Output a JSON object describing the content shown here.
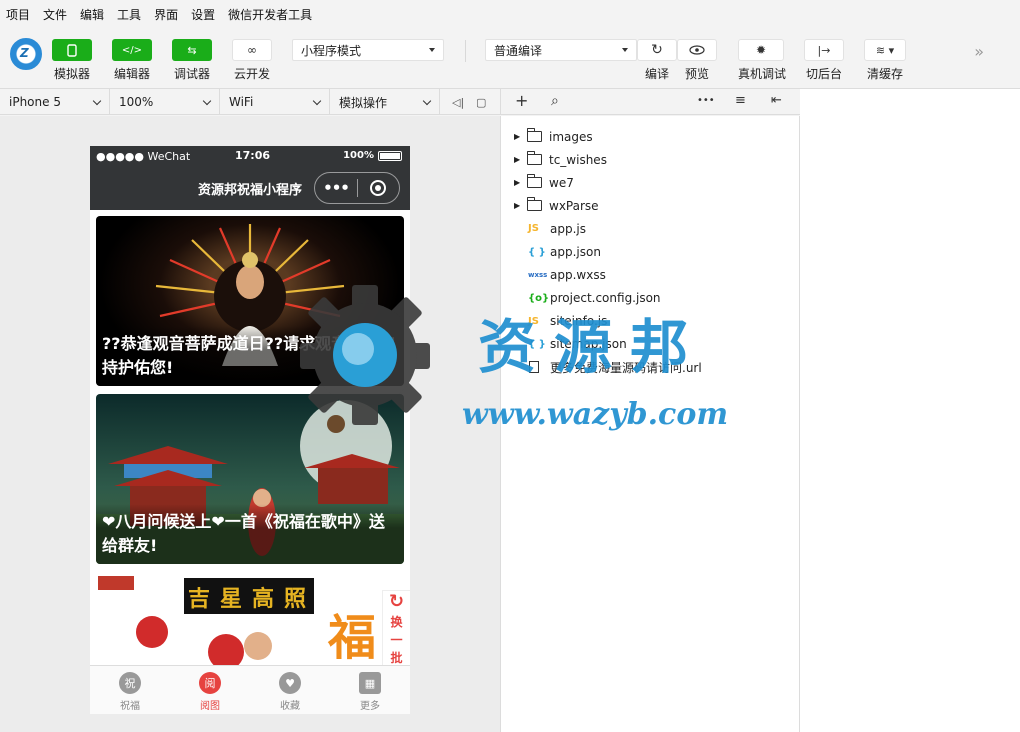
{
  "menu": [
    "项目",
    "文件",
    "编辑",
    "工具",
    "界面",
    "设置",
    "微信开发者工具"
  ],
  "toolbar": {
    "simulator": "模拟器",
    "editor": "编辑器",
    "debugger": "调试器",
    "cloud": "云开发",
    "mode": "小程序模式",
    "compile_mode": "普通编译",
    "compile": "编译",
    "preview": "预览",
    "remote_debug": "真机调试",
    "background": "切后台",
    "clear_cache": "清缓存"
  },
  "subbar": {
    "device": "iPhone 5",
    "zoom": "100%",
    "network": "WiFi",
    "operation": "模拟操作"
  },
  "phone": {
    "carrier": "●●●●● WeChat",
    "time": "17:06",
    "battery": "100%",
    "nav_title": "资源邦祝福小程序",
    "capsule_dots": "•••",
    "cards": [
      {
        "caption": "??恭逢观音菩萨成道日??请求观音菩萨加持护佑您!"
      },
      {
        "caption": "❤八月问候送上❤一首《祝福在歌中》送给群友!"
      },
      {
        "caption": ""
      }
    ],
    "card3_text": [
      "吉",
      "星",
      "高",
      "照"
    ],
    "card3_fu": "福",
    "refresh": {
      "icon": "↻",
      "line1": "换",
      "line2": "一",
      "line3": "批"
    },
    "tabs": [
      {
        "label": "祝福",
        "icon": "祝",
        "active": false
      },
      {
        "label": "阅图",
        "icon": "阅",
        "active": true
      },
      {
        "label": "收藏",
        "icon": "♥",
        "active": false
      },
      {
        "label": "更多",
        "icon": "▦",
        "active": false
      }
    ]
  },
  "tree_toolbar": {
    "add": "+",
    "search": "⌕",
    "more": "•••",
    "sort": "≡",
    "collapse": "⇤"
  },
  "files": [
    {
      "name": "images",
      "type": "folder"
    },
    {
      "name": "tc_wishes",
      "type": "folder"
    },
    {
      "name": "we7",
      "type": "folder"
    },
    {
      "name": "wxParse",
      "type": "folder"
    },
    {
      "name": "app.js",
      "type": "js",
      "icon": "JS"
    },
    {
      "name": "app.json",
      "type": "json",
      "icon": "{ }"
    },
    {
      "name": "app.wxss",
      "type": "wxss",
      "icon": "wxss"
    },
    {
      "name": "project.config.json",
      "type": "cfg",
      "icon": "{o}"
    },
    {
      "name": "siteinfo.js",
      "type": "js",
      "icon": "JS"
    },
    {
      "name": "sitemap.json",
      "type": "json",
      "icon": "{ }"
    },
    {
      "name": "更多免费海量源码请访问.url",
      "type": "doc"
    }
  ],
  "watermark": {
    "text": "资源邦",
    "url": "www.wazyb.com"
  }
}
